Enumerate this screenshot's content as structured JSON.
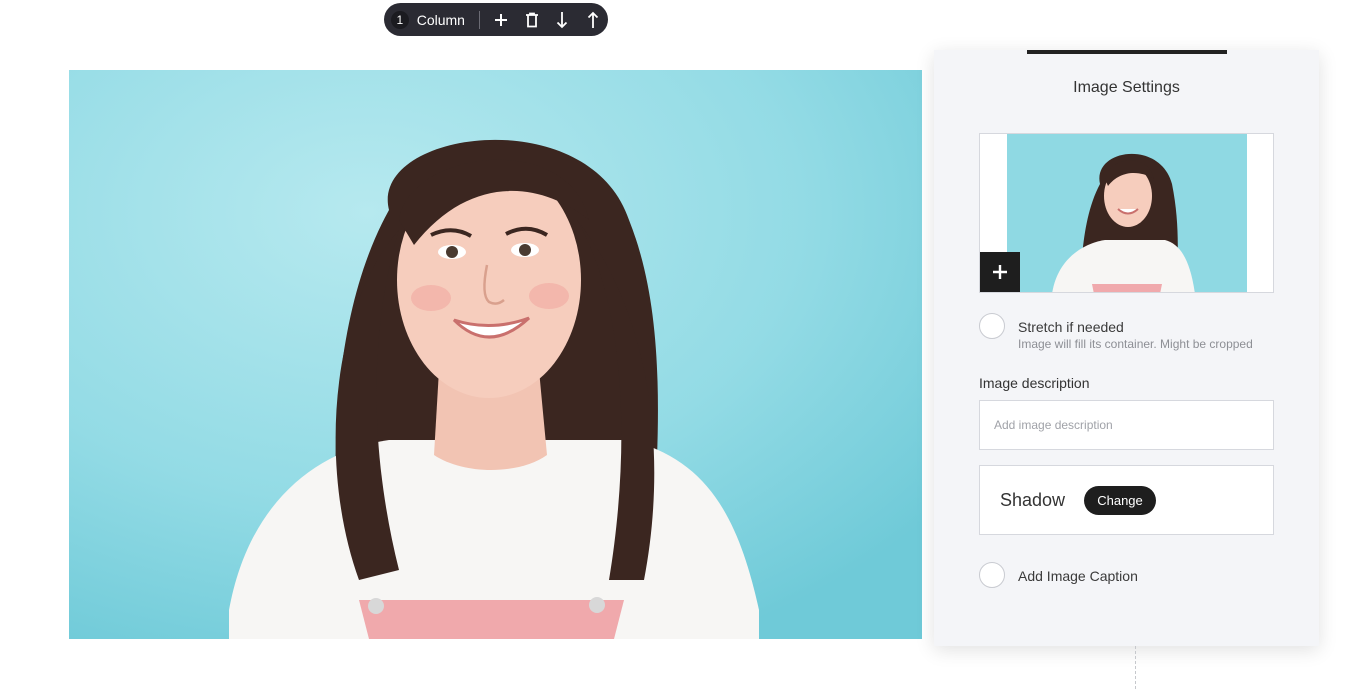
{
  "toolbar": {
    "index": "1",
    "label": "Column",
    "actions": [
      {
        "name": "add-icon"
      },
      {
        "name": "trash-icon"
      },
      {
        "name": "arrow-down-icon"
      },
      {
        "name": "arrow-up-icon"
      }
    ]
  },
  "colors": {
    "photo_background": "#8fd9e3",
    "toolbar_background": "#2b2b33",
    "panel_background": "#f4f5f8",
    "button_dark": "#1e1e1e"
  },
  "panel": {
    "title": "Image Settings",
    "thumbnail_add_icon": "plus-icon",
    "stretch": {
      "label": "Stretch if needed",
      "hint": "Image will fill its container. Might be cropped"
    },
    "description": {
      "label": "Image description",
      "placeholder": "Add image description"
    },
    "shadow": {
      "label": "Shadow",
      "button": "Change"
    },
    "caption": {
      "label": "Add Image Caption"
    }
  }
}
